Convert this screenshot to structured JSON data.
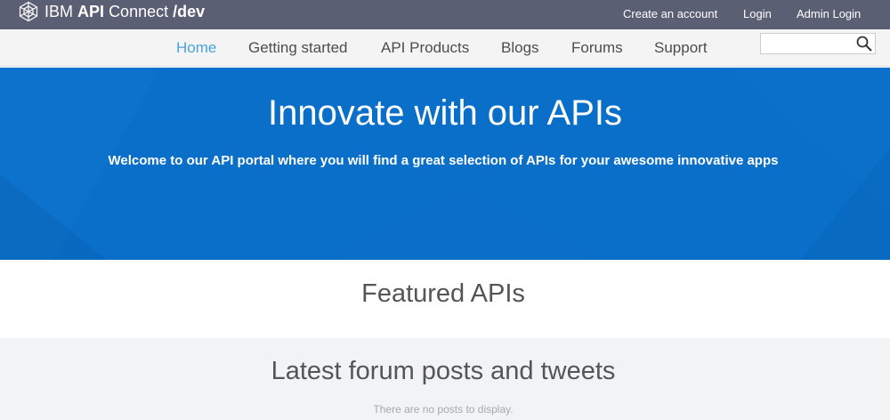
{
  "topbar": {
    "brand": {
      "ibm": "IBM",
      "api": "API",
      "connect": "Connect",
      "dev": "/dev",
      "logo_icon": "ibm-api-connect-logo-icon"
    },
    "links": {
      "create_account": "Create an account",
      "login": "Login",
      "admin_login": "Admin Login"
    }
  },
  "nav": {
    "items": [
      {
        "label": "Home",
        "active": true
      },
      {
        "label": "Getting started",
        "active": false
      },
      {
        "label": "API Products",
        "active": false
      },
      {
        "label": "Blogs",
        "active": false
      },
      {
        "label": "Forums",
        "active": false
      },
      {
        "label": "Support",
        "active": false
      }
    ],
    "search": {
      "value": "",
      "placeholder": "",
      "icon": "search-icon"
    }
  },
  "hero": {
    "title": "Innovate with our APIs",
    "subtitle": "Welcome to our API portal where you will find a great selection of APIs for your awesome innovative apps"
  },
  "featured": {
    "title": "Featured APIs"
  },
  "forum": {
    "title": "Latest forum posts and tweets",
    "empty_message": "There are no posts to display."
  },
  "colors": {
    "topbar_bg": "#5b5f73",
    "nav_bg": "#f4f4f4",
    "nav_active": "#4aa3df",
    "hero_bg": "#0a6fc8",
    "forum_bg": "#f1f3f4"
  }
}
